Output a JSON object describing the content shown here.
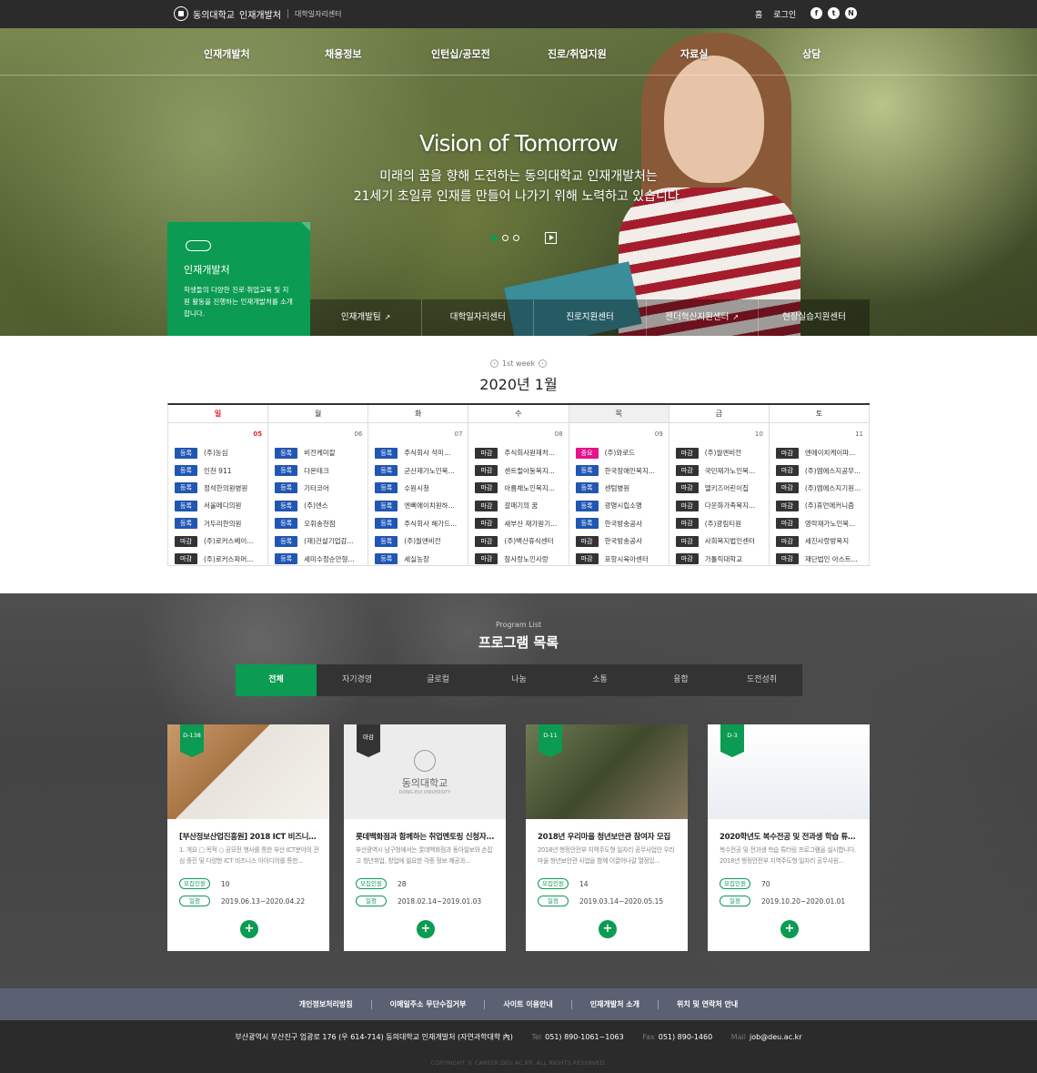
{
  "topbar": {
    "logo_text": "동의대학교",
    "site_title": "인재개발처",
    "sub_title": "대학일자리센터",
    "links": [
      "홈",
      "로그인"
    ],
    "socials": [
      "f",
      "t",
      "N"
    ]
  },
  "nav": [
    "인재개발처",
    "채용정보",
    "인턴십/공모전",
    "진로/취업지원",
    "자료실",
    "상담"
  ],
  "hero": {
    "title": "Vision of Tomorrow",
    "desc_line1": "미래의 꿈을 향해 도전하는 동의대학교 인재개발처는",
    "desc_line2": "21세기 초일류 인재를 만들어 나가기 위해 노력하고 있습니다."
  },
  "green_box": {
    "title": "인재개발처",
    "desc": "학생들의 다양한 진로·취업교육 및 지원 활동을 진행하는 인재개발처를 소개합니다."
  },
  "quick_links": [
    {
      "label": "인재개발팀",
      "external": true
    },
    {
      "label": "대학일자리센터",
      "external": false
    },
    {
      "label": "진로지원센터",
      "external": false
    },
    {
      "label": "젠더혁신지원센터",
      "external": true
    },
    {
      "label": "현장실습지원센터",
      "external": false
    }
  ],
  "calendar": {
    "week_label": "1st week",
    "month": "2020년 1월",
    "days": [
      {
        "name": "일",
        "date": "05",
        "items": [
          [
            "등록",
            "b",
            "(주)농심"
          ],
          [
            "등록",
            "b",
            "인천 911"
          ],
          [
            "등록",
            "b",
            "정석한의원병원"
          ],
          [
            "등록",
            "b",
            "서울메디의원"
          ],
          [
            "등록",
            "b",
            "거두리한의원"
          ],
          [
            "마감",
            "k",
            "(주)로커스베이..."
          ],
          [
            "마감",
            "k",
            "(주)로커스파머..."
          ]
        ]
      },
      {
        "name": "월",
        "date": "06",
        "items": [
          [
            "등록",
            "b",
            "비전케미칼"
          ],
          [
            "등록",
            "b",
            "다온테크"
          ],
          [
            "등록",
            "b",
            "기타코어"
          ],
          [
            "등록",
            "b",
            "(주)엔스"
          ],
          [
            "등록",
            "b",
            "오휘송천점"
          ],
          [
            "등록",
            "b",
            "(재)건설기업감..."
          ],
          [
            "등록",
            "b",
            "세미수정순안형..."
          ]
        ]
      },
      {
        "name": "화",
        "date": "07",
        "items": [
          [
            "등록",
            "b",
            "주식회사 석미..."
          ],
          [
            "등록",
            "b",
            "군산재가노인복..."
          ],
          [
            "등록",
            "b",
            "수원시청"
          ],
          [
            "등록",
            "b",
            "엔삐에이치원하..."
          ],
          [
            "등록",
            "b",
            "주식회사 해가드..."
          ],
          [
            "등록",
            "b",
            "(주)월앤비전"
          ],
          [
            "등록",
            "b",
            "세실농장"
          ]
        ]
      },
      {
        "name": "수",
        "date": "08",
        "items": [
          [
            "마감",
            "k",
            "주식회사원재처..."
          ],
          [
            "마감",
            "k",
            "센트럴아동복지..."
          ],
          [
            "마감",
            "k",
            "아름채노인복지..."
          ],
          [
            "마감",
            "k",
            "갈매기의 꿈"
          ],
          [
            "마감",
            "k",
            "새부산 재가원기..."
          ],
          [
            "마감",
            "k",
            "(주)백산휴식센터"
          ],
          [
            "마감",
            "k",
            "참사랑노인사랑"
          ]
        ]
      },
      {
        "name": "목",
        "date": "09",
        "items": [
          [
            "중요",
            "p",
            "(주)와로드"
          ],
          [
            "등록",
            "b",
            "한국장애인복지..."
          ],
          [
            "등록",
            "b",
            "센텀병원"
          ],
          [
            "등록",
            "b",
            "광명시립소명"
          ],
          [
            "등록",
            "b",
            "한국방송공사"
          ],
          [
            "마감",
            "k",
            "한국방송공사"
          ],
          [
            "마감",
            "k",
            "포항시육아센터"
          ]
        ]
      },
      {
        "name": "금",
        "date": "10",
        "items": [
          [
            "마감",
            "k",
            "(주)월앤비전"
          ],
          [
            "마감",
            "k",
            "국민재가노인복..."
          ],
          [
            "마감",
            "k",
            "엘키즈어린이집"
          ],
          [
            "마감",
            "k",
            "다운화가족복지..."
          ],
          [
            "마감",
            "k",
            "(주)광림티원"
          ],
          [
            "마감",
            "k",
            "사회복지법인센터"
          ],
          [
            "마감",
            "k",
            "가톨릭대학교"
          ]
        ]
      },
      {
        "name": "토",
        "date": "11",
        "items": [
          [
            "마감",
            "k",
            "엔에이치케이파..."
          ],
          [
            "마감",
            "k",
            "(주)엠에스지공무..."
          ],
          [
            "마감",
            "k",
            "(주)엠에스지기원..."
          ],
          [
            "마감",
            "k",
            "(주)휴먼에커니즘"
          ],
          [
            "마감",
            "k",
            "영락재가노인복..."
          ],
          [
            "마감",
            "k",
            "세진사랑방복지"
          ],
          [
            "마감",
            "k",
            "재단법인 아스트..."
          ]
        ]
      }
    ]
  },
  "programs": {
    "subtitle": "Program List",
    "title": "프로그램 목록",
    "tabs": [
      "전체",
      "자기경영",
      "글로컬",
      "나눔",
      "소통",
      "융합",
      "도전성취"
    ],
    "cards": [
      {
        "badge": "D-138",
        "badge_type": "g",
        "title": "[부산정보산업진흥원] 2018 ICT 비즈니스 아...",
        "desc": "1. 개요 □ 목적 ○ 공모전 행사를 통한 부산 ICT분야의 관심 증진 및 다양한 ICT 비즈니스 아이디어를 통한...",
        "recruit_label": "모집인원",
        "recruit": "10",
        "period_label": "일정",
        "period": "2019.06.13~2020.04.22"
      },
      {
        "badge": "마감",
        "badge_type": "k",
        "title": "롯데백화점과 함께하는 취업멘토링 신청자...",
        "desc": "부산광역시 남구청에서는 롯데백화점과 동아일보와 손잡고 청년취업, 창업에 필요한 각종 정보 제공과...",
        "recruit_label": "모집인원",
        "recruit": "28",
        "period_label": "일정",
        "period": "2018.02.14~2019.01.03",
        "logo_text": "동의대학교",
        "logo_sub": "DONG-EUI UNIVERSITY"
      },
      {
        "badge": "D-11",
        "badge_type": "g",
        "title": "2018년 우리마을 청년보안관 참여자 모집",
        "desc": "2018년 행정안전부 지역주도형 일자리 공무사업인 우리마을 청년보안관 사업을 함께 이끌어나갈 열정있...",
        "recruit_label": "모집인원",
        "recruit": "14",
        "period_label": "일정",
        "period": "2019.03.14~2020.05.15"
      },
      {
        "badge": "D-3",
        "badge_type": "g",
        "title": "2020학년도 복수전공 및 전과생 학습 튜터링 ...",
        "desc": "복수전공 및 전과생 학습 튜터링 프로그램을 실시합니다. 2018년 행정안전부 지역주도형 일자리 공무사원...",
        "recruit_label": "모집인원",
        "recruit": "70",
        "period_label": "일정",
        "period": "2019.10.20~2020.01.01"
      }
    ]
  },
  "footer": {
    "links": [
      "개인정보처리방침",
      "이메일주소 무단수집거부",
      "사이트 이용안내",
      "인재개발처 소개",
      "위치 및 연락처 안내"
    ],
    "address": "부산광역시 부산진구 엄광로 176 (우 614-714) 동의대학교 인재개발처 (자연과학대학 內)",
    "tel_label": "Tel",
    "tel": "051) 890-1061~1063",
    "fax_label": "Fax",
    "fax": "051) 890-1460",
    "mail_label": "Mail",
    "mail": "job@deu.ac.kr",
    "copyright": "COPYRIGHT © CAREER.DEU.AC.KR. ALL RIGHTS RESERVED."
  },
  "colors": {
    "brand_green": "#0b9b52",
    "tag_blue": "#2156b3",
    "tag_dark": "#333333",
    "tag_pink": "#e6138c"
  }
}
